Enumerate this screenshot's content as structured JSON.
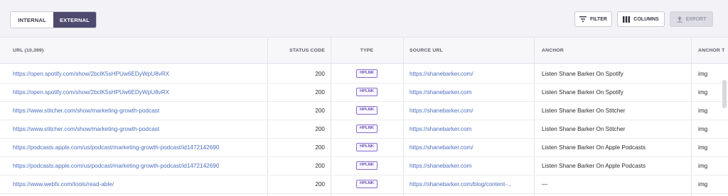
{
  "toolbar": {
    "tabs": [
      {
        "label": "INTERNAL",
        "selected": false
      },
      {
        "label": "EXTERNAL",
        "selected": true
      }
    ],
    "filter_label": "FILTER",
    "columns_label": "COLUMNS",
    "export_label": "EXPORT"
  },
  "table": {
    "headers": {
      "url": "URL (10,399)",
      "status": "STATUS CODE",
      "type": "TYPE",
      "source": "SOURCE URL",
      "anchor": "ANCHOR",
      "anchor2": "ANCHOR T"
    },
    "rows": [
      {
        "url": "https://open.spotify.com/show/2bclK5sHPUw6EDyWpU8vRX",
        "status": "200",
        "type": "HPLNK",
        "source": "https://shanebarker.com/",
        "anchor": "Listen Shane Barker On Spotify",
        "anchor2": "img"
      },
      {
        "url": "https://open.spotify.com/show/2bclK5sHPUw6EDyWpU8vRX",
        "status": "200",
        "type": "HPLNK",
        "source": "https://shanebarker.com",
        "anchor": "Listen Shane Barker On Spotify",
        "anchor2": "img"
      },
      {
        "url": "https://www.stitcher.com/show/marketing-growth-podcast",
        "status": "200",
        "type": "HPLNK",
        "source": "https://shanebarker.com/",
        "anchor": "Listen Shane Barker On Stitcher",
        "anchor2": "img"
      },
      {
        "url": "https://www.stitcher.com/show/marketing-growth-podcast",
        "status": "200",
        "type": "HPLNK",
        "source": "https://shanebarker.com",
        "anchor": "Listen Shane Barker On Stitcher",
        "anchor2": "img"
      },
      {
        "url": "https://podcasts.apple.com/us/podcast/marketing-growth-podcast/id1472142690",
        "status": "200",
        "type": "HPLNK",
        "source": "https://shanebarker.com/",
        "anchor": "Listen Shane Barker On Apple Podcasts",
        "anchor2": "img"
      },
      {
        "url": "https://podcasts.apple.com/us/podcast/marketing-growth-podcast/id1472142690",
        "status": "200",
        "type": "HPLNK",
        "source": "https://shanebarker.com",
        "anchor": "Listen Shane Barker On Apple Podcasts",
        "anchor2": "img"
      },
      {
        "url": "https://www.webfx.com/tools/read-able/",
        "status": "200",
        "type": "HPLNK",
        "source": "https://shanebarker.com/blog/content-...",
        "anchor": "—",
        "anchor2": "img"
      }
    ]
  },
  "icons": {
    "filter": "filter-icon",
    "columns": "columns-icon",
    "export": "export-icon"
  }
}
